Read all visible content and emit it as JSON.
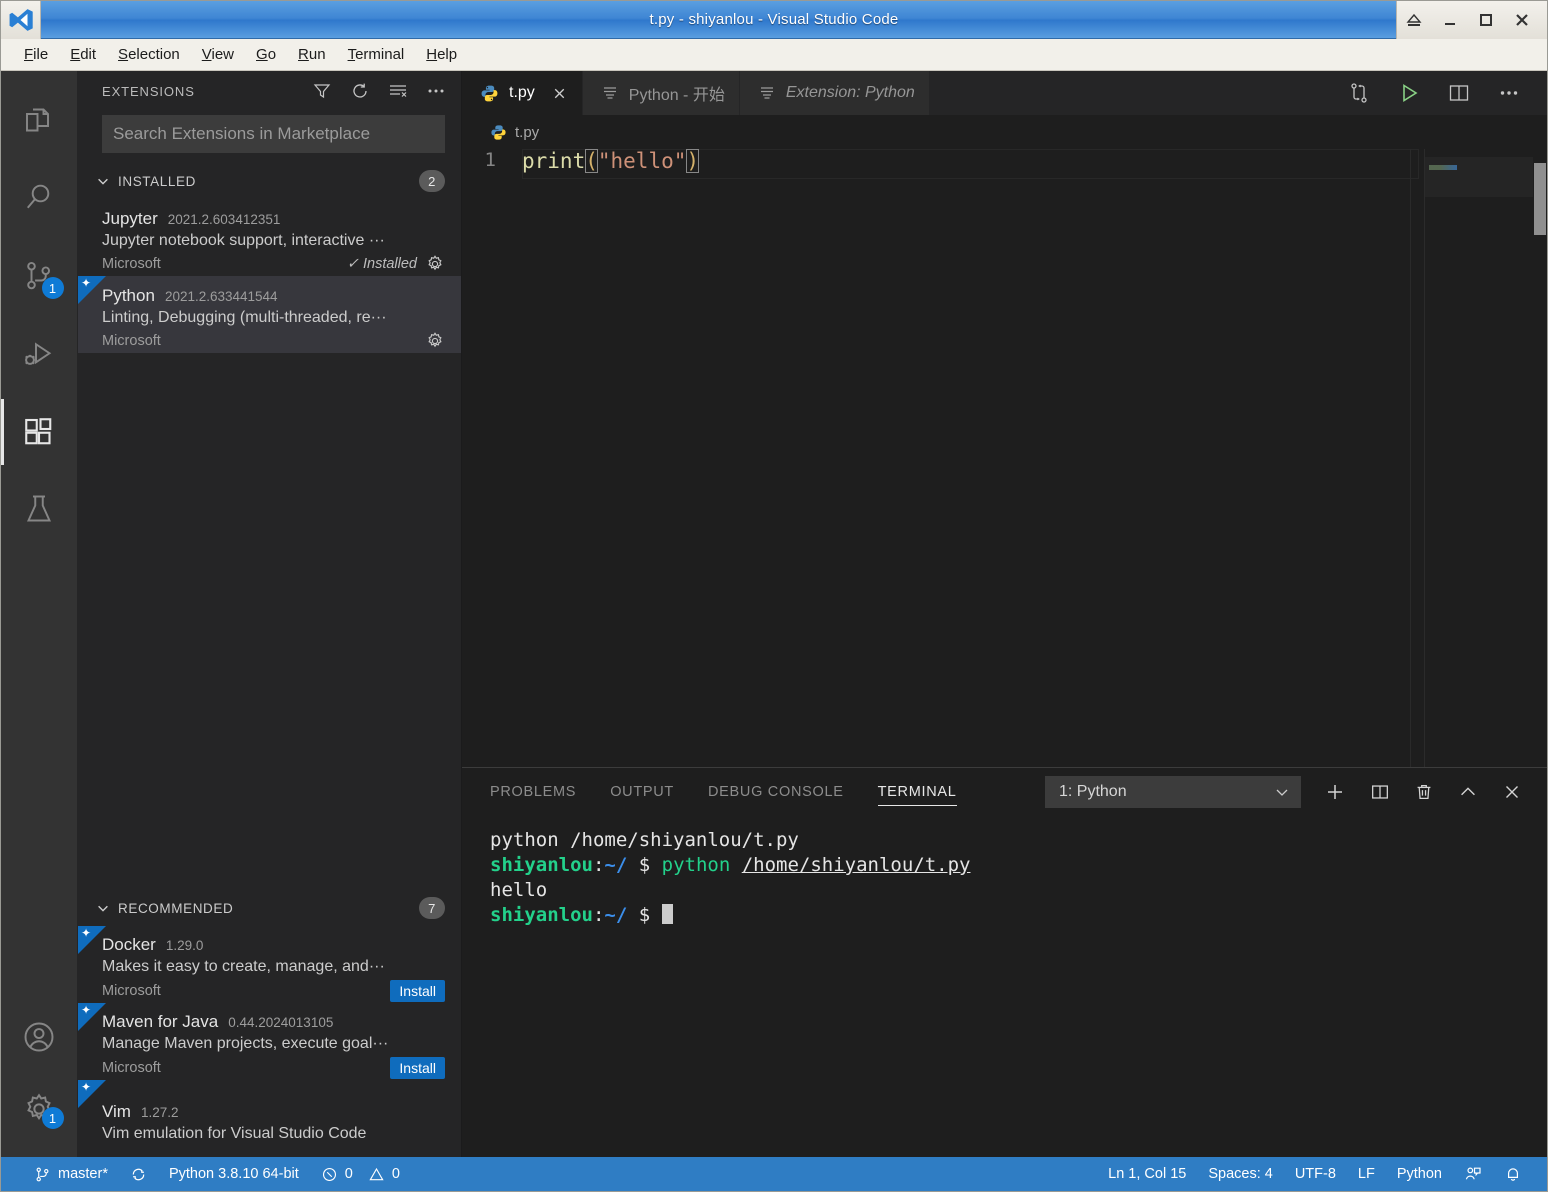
{
  "titlebar": {
    "title": "t.py - shiyanlou - Visual Studio Code",
    "controls": [
      {
        "name": "eject-icon",
        "label": "⏏"
      },
      {
        "name": "minimize-icon",
        "label": "_"
      },
      {
        "name": "maximize-icon",
        "label": "□"
      },
      {
        "name": "close-icon",
        "label": "✕"
      }
    ]
  },
  "menubar": {
    "items": [
      "File",
      "Edit",
      "Selection",
      "View",
      "Go",
      "Run",
      "Terminal",
      "Help"
    ]
  },
  "activitybar": {
    "items": [
      {
        "name": "explorer",
        "icon": "files-icon",
        "badge": null,
        "active": false
      },
      {
        "name": "search",
        "icon": "search-icon",
        "badge": null,
        "active": false
      },
      {
        "name": "source-control",
        "icon": "source-control-icon",
        "badge": "1",
        "active": false
      },
      {
        "name": "run-and-debug",
        "icon": "debug-icon",
        "badge": null,
        "active": false
      },
      {
        "name": "extensions",
        "icon": "extensions-icon",
        "badge": null,
        "active": true
      },
      {
        "name": "testing",
        "icon": "beaker-icon",
        "badge": null,
        "active": false
      }
    ],
    "bottom": [
      {
        "name": "accounts",
        "icon": "account-icon",
        "badge": null
      },
      {
        "name": "settings",
        "icon": "gear-icon",
        "badge": "1"
      }
    ]
  },
  "sidebar": {
    "title": "EXTENSIONS",
    "actions": [
      {
        "name": "filter-icon"
      },
      {
        "name": "refresh-icon"
      },
      {
        "name": "clear-search-results-icon"
      },
      {
        "name": "more-actions-icon"
      }
    ],
    "search": {
      "value": "",
      "placeholder": "Search Extensions in Marketplace"
    },
    "sections": [
      {
        "title": "INSTALLED",
        "count": "2",
        "items": [
          {
            "name": "Jupyter",
            "version": "2021.2.603412351",
            "description": "Jupyter notebook support, interactive ···",
            "publisher": "Microsoft",
            "status": "Installed",
            "status_check": "✓",
            "action": null,
            "selected": false,
            "ribbon": false
          },
          {
            "name": "Python",
            "version": "2021.2.633441544",
            "description": "Linting, Debugging (multi-threaded, re···",
            "publisher": "Microsoft",
            "status": null,
            "status_check": null,
            "action": null,
            "selected": true,
            "ribbon": true
          }
        ]
      },
      {
        "title": "RECOMMENDED",
        "count": "7",
        "items": [
          {
            "name": "Docker",
            "version": "1.29.0",
            "description": "Makes it easy to create, manage, and···",
            "publisher": "Microsoft",
            "status": null,
            "status_check": null,
            "action": "Install",
            "selected": false,
            "ribbon": true
          },
          {
            "name": "Maven for Java",
            "version": "0.44.2024013105",
            "description": "Manage Maven projects, execute goal···",
            "publisher": "Microsoft",
            "status": null,
            "status_check": null,
            "action": "Install",
            "selected": false,
            "ribbon": true
          },
          {
            "name": "Vim",
            "version": "1.27.2",
            "description": "Vim emulation for Visual Studio Code",
            "publisher": "",
            "status": null,
            "status_check": null,
            "action": null,
            "selected": false,
            "ribbon": true
          }
        ]
      }
    ]
  },
  "editor": {
    "tabs": [
      {
        "label": "t.py",
        "icon": "python-file-icon",
        "active": true,
        "preview": false,
        "closable": true
      },
      {
        "label": "Python - 开始",
        "icon": "walkthrough-icon",
        "active": false,
        "preview": false,
        "closable": false
      },
      {
        "label": "Extension: Python",
        "icon": "extension-page-icon",
        "active": false,
        "preview": true,
        "closable": false
      }
    ],
    "actions": [
      {
        "name": "run-python-file-in-dedicated-terminal-icon"
      },
      {
        "name": "run-python-file-icon"
      },
      {
        "name": "split-editor-icon"
      },
      {
        "name": "more-editor-actions-icon"
      }
    ],
    "breadcrumb": "t.py",
    "line_number": "1",
    "code": {
      "fn": "print",
      "open_paren": "(",
      "string": "\"hello\"",
      "close_paren": ")"
    }
  },
  "panel": {
    "tabs": [
      {
        "label": "PROBLEMS",
        "active": false
      },
      {
        "label": "OUTPUT",
        "active": false
      },
      {
        "label": "DEBUG CONSOLE",
        "active": false
      },
      {
        "label": "TERMINAL",
        "active": true
      }
    ],
    "terminal_select": "1: Python",
    "icons": [
      {
        "name": "new-terminal-icon"
      },
      {
        "name": "split-terminal-icon"
      },
      {
        "name": "kill-terminal-icon"
      },
      {
        "name": "maximize-panel-icon"
      },
      {
        "name": "close-panel-icon"
      }
    ],
    "terminal_lines": [
      {
        "type": "plain",
        "text": "python /home/shiyanlou/t.py"
      },
      {
        "type": "prompt",
        "user": "shiyanlou",
        "colon": ":",
        "path": "~/",
        "dollar": " $ ",
        "cmd": "python",
        "arg": "/home/shiyanlou/t.py"
      },
      {
        "type": "plain",
        "text": "hello"
      },
      {
        "type": "prompt_cursor",
        "user": "shiyanlou",
        "colon": ":",
        "path": "~/",
        "dollar": " $ "
      }
    ]
  },
  "statusbar": {
    "left": [
      {
        "name": "remote-branch",
        "icon": "git-branch-icon",
        "label": "master*"
      },
      {
        "name": "sync-changes",
        "icon": "sync-icon",
        "label": ""
      },
      {
        "name": "python-interpreter",
        "icon": null,
        "label": "Python 3.8.10 64-bit"
      },
      {
        "name": "errors",
        "icon": "error-icon",
        "label": "0"
      },
      {
        "name": "warnings",
        "icon": "warning-icon",
        "label": "0"
      }
    ],
    "right": [
      {
        "name": "editor-position",
        "icon": null,
        "label": "Ln 1, Col 15"
      },
      {
        "name": "editor-indentation",
        "icon": null,
        "label": "Spaces: 4"
      },
      {
        "name": "editor-encoding",
        "icon": null,
        "label": "UTF-8"
      },
      {
        "name": "editor-eol",
        "icon": null,
        "label": "LF"
      },
      {
        "name": "editor-language",
        "icon": null,
        "label": "Python"
      },
      {
        "name": "feedback",
        "icon": "feedback-icon",
        "label": ""
      },
      {
        "name": "notifications",
        "icon": "bell-icon",
        "label": ""
      }
    ]
  },
  "colors": {
    "accent": "#0f6cbd",
    "statusbar": "#2f7dc4",
    "editor_bg": "#1e1e1e",
    "sidebar_bg": "#252526",
    "activitybar_bg": "#333333"
  }
}
